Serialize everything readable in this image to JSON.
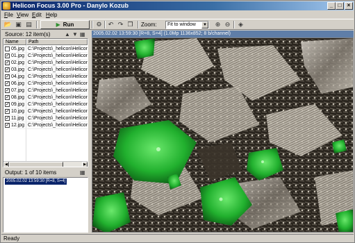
{
  "window": {
    "title": "Helicon Focus 3.00 Pro - Danylo Kozub"
  },
  "menu": [
    {
      "label": "File",
      "accel": "F"
    },
    {
      "label": "View",
      "accel": "V"
    },
    {
      "label": "Edit",
      "accel": "E"
    },
    {
      "label": "Help",
      "accel": "H"
    }
  ],
  "toolbar": {
    "run_label": "Run",
    "zoom_label": "Zoom:",
    "zoom_value": "Fit to window"
  },
  "source": {
    "title": "Source: 12 item(s)",
    "columns": [
      "Name",
      "Path"
    ],
    "rows": [
      {
        "checked": false,
        "name": "05.jpg",
        "path": "C:\\Projects\\_helicon\\Helicon"
      },
      {
        "checked": true,
        "name": "01.jpg",
        "path": "C:\\Projects\\_helicon\\Helicon"
      },
      {
        "checked": true,
        "name": "02.jpg",
        "path": "C:\\Projects\\_helicon\\Helicon"
      },
      {
        "checked": true,
        "name": "03.jpg",
        "path": "C:\\Projects\\_helicon\\Helicon"
      },
      {
        "checked": true,
        "name": "04.jpg",
        "path": "C:\\Projects\\_helicon\\Helicon"
      },
      {
        "checked": true,
        "name": "06.jpg",
        "path": "C:\\Projects\\_helicon\\Helicon"
      },
      {
        "checked": true,
        "name": "07.jpg",
        "path": "C:\\Projects\\_helicon\\Helicon"
      },
      {
        "checked": true,
        "name": "08.jpg",
        "path": "C:\\Projects\\_helicon\\Helicon"
      },
      {
        "checked": true,
        "name": "09.jpg",
        "path": "C:\\Projects\\_helicon\\Helicon"
      },
      {
        "checked": true,
        "name": "10.jpg",
        "path": "C:\\Projects\\_helicon\\Helicon"
      },
      {
        "checked": true,
        "name": "11.jpg",
        "path": "C:\\Projects\\_helicon\\Helicon"
      },
      {
        "checked": true,
        "name": "12.jpg",
        "path": "C:\\Projects\\_helicon\\Helicon"
      }
    ]
  },
  "output": {
    "title": "Output: 1 of 10 items",
    "items": [
      "2005.02.02 13:59:30 [R=8, S=4]"
    ]
  },
  "image": {
    "info": "2005.02.02 13:59:30 [R=8, S=4] (1.0Mp 1136x852; 8 b/channel)"
  },
  "status": {
    "text": "Ready"
  },
  "colors": {
    "title_active": "#0a246a",
    "image_header": "#5f7ea8",
    "crystal_green": "#2fc83a",
    "chrome": "#d4d0c8"
  }
}
